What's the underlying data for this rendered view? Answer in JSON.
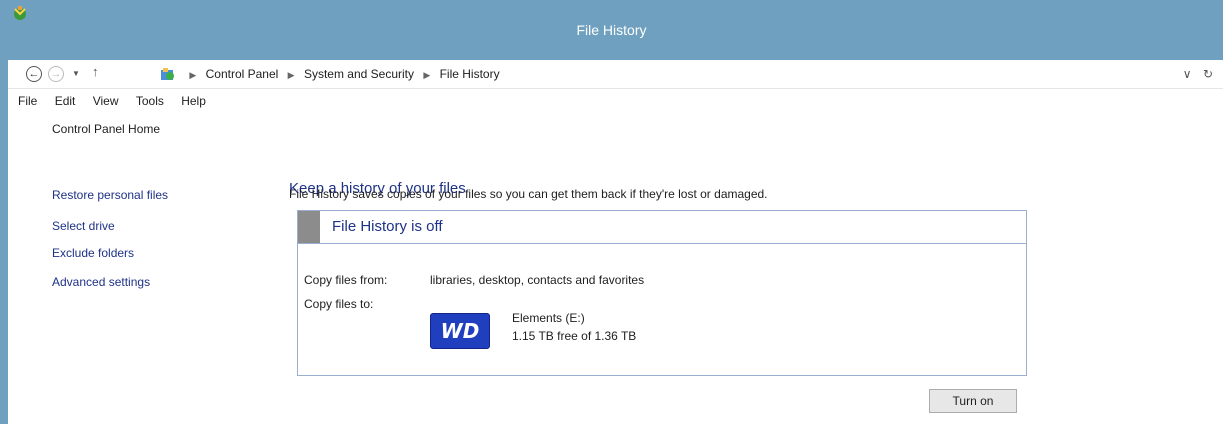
{
  "window": {
    "title": "File History"
  },
  "address": {
    "crumbs": [
      "Control Panel",
      "System and Security",
      "File History"
    ],
    "dropdown_glyph": "∨",
    "refresh_glyph": "↻"
  },
  "menu": [
    "File",
    "Edit",
    "View",
    "Tools",
    "Help"
  ],
  "sidebar": {
    "home": "Control Panel Home",
    "tasks": [
      "Restore personal files",
      "Select drive",
      "Exclude folders",
      "Advanced settings"
    ]
  },
  "main": {
    "heading": "Keep a history of your files",
    "description": "File History saves copies of your files so you can get them back if they're lost or damaged.",
    "status": "File History is off",
    "copy_from_label": "Copy files from:",
    "copy_from_value": "libraries, desktop, contacts and favorites",
    "copy_to_label": "Copy files to:",
    "drive_logo_text": "WD",
    "drive_name": "Elements (E:)",
    "drive_space": "1.15 TB free of 1.36 TB",
    "turn_on_label": "Turn on"
  },
  "colors": {
    "titlebar": "#6fa0c0",
    "link": "#1e3287",
    "panel_border": "#9aaed0",
    "wd_blue": "#1f3fbf"
  }
}
